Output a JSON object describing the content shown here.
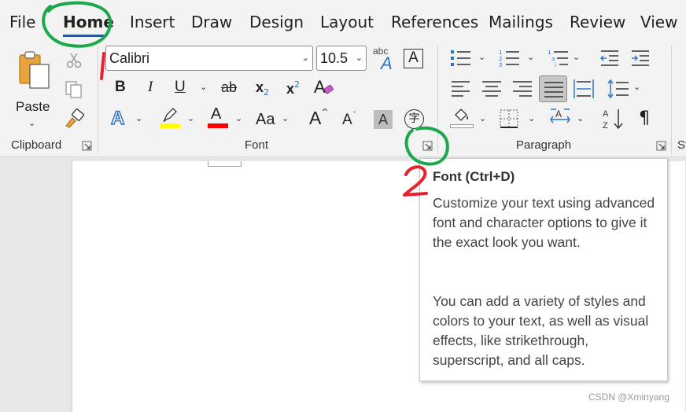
{
  "tabs": {
    "file": "File",
    "home": "Home",
    "insert": "Insert",
    "draw": "Draw",
    "design": "Design",
    "layout": "Layout",
    "references": "References",
    "mailings": "Mailings",
    "review": "Review",
    "view": "View"
  },
  "clipboard": {
    "paste_label": "Paste",
    "group_label": "Clipboard"
  },
  "font": {
    "name_value": "Calibri",
    "size_value": "10.5",
    "phonetic_text": "abc",
    "bold": "B",
    "italic": "I",
    "underline": "U",
    "strike": "ab",
    "subscript": "x",
    "superscript": "x",
    "subscript_mark": "2",
    "superscript_mark": "2",
    "change_case": "Aa",
    "grow": "A",
    "shrink": "A",
    "shade_char": "A",
    "enclose_char": "字",
    "group_label": "Font"
  },
  "paragraph": {
    "group_label": "Paragraph",
    "next_group_label": "St"
  },
  "tooltip": {
    "title": "Font (Ctrl+D)",
    "paragraph1": "Customize your text using advanced font and character options to give it the exact look you want.",
    "paragraph2": "You can add a variety of styles and colors to your text, as well as visual effects, like strikethrough, superscript, and all caps."
  },
  "annotations": {
    "step1": "1",
    "step2": "2"
  },
  "watermark": "CSDN @Xminyang",
  "colors": {
    "accent_blue": "#2b579a",
    "annotation_green": "#1aa84a",
    "annotation_red": "#e8212a",
    "highlight_yellow": "#ffff00",
    "font_color_red": "#ff0000"
  }
}
